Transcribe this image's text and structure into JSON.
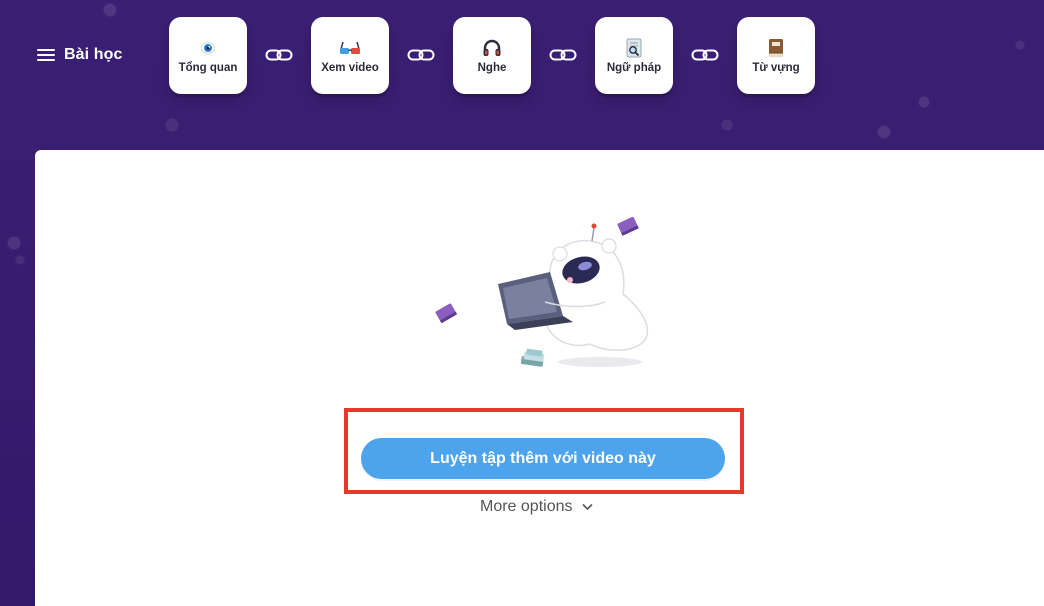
{
  "header": {
    "menu_label": "Bài học",
    "tabs": [
      {
        "label": "Tổng quan",
        "icon": "eye-icon"
      },
      {
        "label": "Xem video",
        "icon": "3d-glasses-icon"
      },
      {
        "label": "Nghe",
        "icon": "headphones-icon"
      },
      {
        "label": "Ngữ pháp",
        "icon": "magnifier-document-icon"
      },
      {
        "label": "Từ vựng",
        "icon": "book-icon"
      }
    ],
    "connector_icon": "chain-link-icon"
  },
  "main": {
    "illustration": "mascot-with-laptop-icon",
    "cta_label": "Luyện tập thêm với video này",
    "more_options_label": "More options",
    "more_options_icon": "chevron-down-icon"
  },
  "colors": {
    "background": "#3a1f72",
    "card": "#ffffff",
    "cta": "#4da4ec",
    "highlight": "#e53a2b"
  }
}
